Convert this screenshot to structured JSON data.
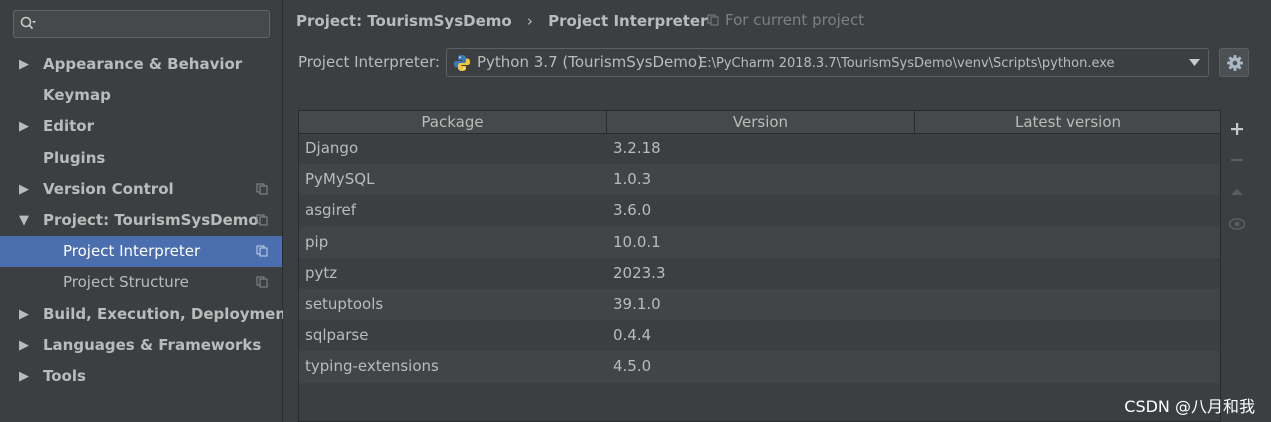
{
  "sidebar": {
    "search": {
      "value": ""
    },
    "items": [
      {
        "label": "Appearance & Behavior",
        "arrow": "▶",
        "copy": false,
        "child": false,
        "selected": false
      },
      {
        "label": "Keymap",
        "arrow": "",
        "copy": false,
        "child": false,
        "selected": false
      },
      {
        "label": "Editor",
        "arrow": "▶",
        "copy": false,
        "child": false,
        "selected": false
      },
      {
        "label": "Plugins",
        "arrow": "",
        "copy": false,
        "child": false,
        "selected": false
      },
      {
        "label": "Version Control",
        "arrow": "▶",
        "copy": true,
        "child": false,
        "selected": false
      },
      {
        "label": "Project: TourismSysDemo",
        "arrow": "▼",
        "copy": true,
        "child": false,
        "selected": false
      },
      {
        "label": "Project Interpreter",
        "arrow": "",
        "copy": true,
        "child": true,
        "selected": true
      },
      {
        "label": "Project Structure",
        "arrow": "",
        "copy": true,
        "child": true,
        "selected": false
      },
      {
        "label": "Build, Execution, Deployment",
        "arrow": "▶",
        "copy": false,
        "child": false,
        "selected": false
      },
      {
        "label": "Languages & Frameworks",
        "arrow": "▶",
        "copy": false,
        "child": false,
        "selected": false
      },
      {
        "label": "Tools",
        "arrow": "▶",
        "copy": false,
        "child": false,
        "selected": false
      }
    ]
  },
  "header": {
    "breadcrumb_parent": "Project: TourismSysDemo",
    "breadcrumb_sep": "›",
    "breadcrumb_current": "Project Interpreter",
    "scope": "For current project"
  },
  "interpreter": {
    "label": "Project Interpreter:",
    "name": "Python 3.7 (TourismSysDemo)",
    "path": "E:\\PyCharm 2018.3.7\\TourismSysDemo\\venv\\Scripts\\python.exe"
  },
  "table": {
    "columns": [
      "Package",
      "Version",
      "Latest version"
    ],
    "rows": [
      {
        "package": "Django",
        "version": "3.2.18",
        "latest": ""
      },
      {
        "package": "PyMySQL",
        "version": "1.0.3",
        "latest": ""
      },
      {
        "package": "asgiref",
        "version": "3.6.0",
        "latest": ""
      },
      {
        "package": "pip",
        "version": "10.0.1",
        "latest": ""
      },
      {
        "package": "pytz",
        "version": "2023.3",
        "latest": ""
      },
      {
        "package": "setuptools",
        "version": "39.1.0",
        "latest": ""
      },
      {
        "package": "sqlparse",
        "version": "0.4.4",
        "latest": ""
      },
      {
        "package": "typing-extensions",
        "version": "4.5.0",
        "latest": ""
      }
    ]
  },
  "tools": [
    "plus-icon",
    "minus-icon",
    "upgrade-icon",
    "eye-icon"
  ],
  "watermark": "CSDN @八月和我",
  "colors": {
    "background": "#3c3f41",
    "selection": "#4b6eaf",
    "text": "#bbbbbb"
  }
}
